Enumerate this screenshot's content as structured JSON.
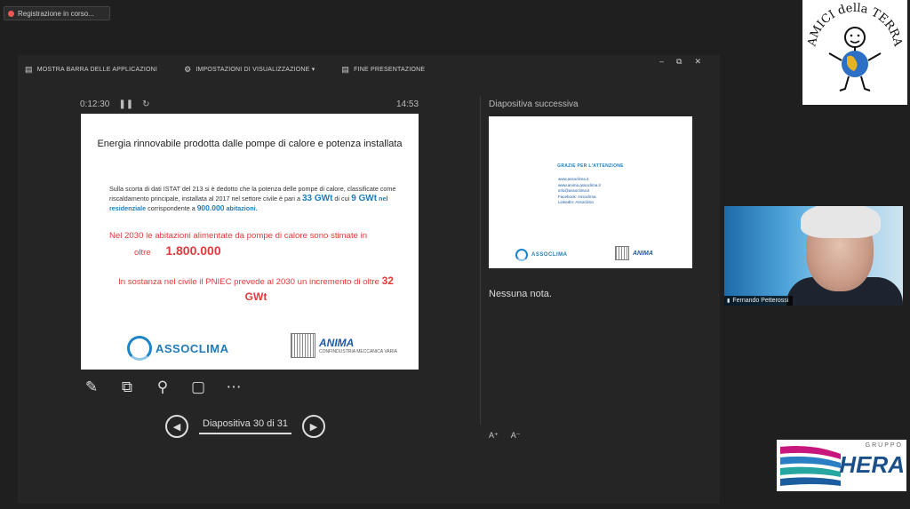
{
  "recording": {
    "label": "Registrazione in corso..."
  },
  "toolbar": {
    "show_taskbar": "MOSTRA BARRA DELLE APPLICAZIONI",
    "display_settings": "IMPOSTAZIONI DI VISUALIZZAZIONE ▾",
    "end_presentation": "FINE PRESENTAZIONE",
    "minimize_glyph": "–",
    "restore_glyph": "⧉",
    "close_glyph": "✕"
  },
  "timer": {
    "elapsed": "0:12:30",
    "clock": "14:53"
  },
  "slide": {
    "title": "Energia rinnovabile prodotta dalle pompe di calore e potenza installata",
    "body_1": "Sulla scorta di dati ISTAT del 213 si è dedotto che la potenza delle pompe di calore, classificate come riscaldamento principale, installata al 2017  nel settore civile è pari a",
    "val_total": "33 GWt",
    "txt_dicui": "di cui",
    "val_res": "9 GWt",
    "txt_res": "nel residenziale",
    "txt_corr": "corrispondente a",
    "val_abit": "900.000",
    "txt_abit": "abitazioni.",
    "red_1": "Nel 2030 le abitazioni alimentate da pompe di calore sono stimate in",
    "red_1_oltre": "oltre",
    "red_1_val": "1.800.000",
    "red_2": "In sostanza nel civile il PNIEC prevede al 2030 un incremento di oltre",
    "red_2_val": "32 GWt",
    "logo_assoclima": "ASSOCLIMA",
    "logo_anima": "ANIMA",
    "logo_anima_sub": "CONFINDUSTRIA MECCANICA VARIA"
  },
  "navigation": {
    "label": "Diapositiva 30 di 31",
    "prev_glyph": "◀",
    "next_glyph": "▶"
  },
  "next_panel": {
    "label": "Diapositiva successiva",
    "thanks": "GRAZIE PER L'ATTENZIONE",
    "links": [
      "www.assoclima.it",
      "www.anima.assoclima.it",
      "info@assoclima.it",
      "Facebook: Assoclima",
      "LinkedIn: Assoclima"
    ],
    "logo_assoclima": "ASSOCLIMA",
    "logo_anima": "ANIMA"
  },
  "notes": {
    "text": "Nessuna nota."
  },
  "font_buttons": {
    "increase": "A⁺",
    "decrease": "A⁻"
  },
  "webcam": {
    "name": "Fernando Petterossi"
  },
  "brand_top": {
    "text": "AMICI della TERRA"
  },
  "brand_bottom": {
    "group": "GRUPPO",
    "name": "HERA"
  }
}
